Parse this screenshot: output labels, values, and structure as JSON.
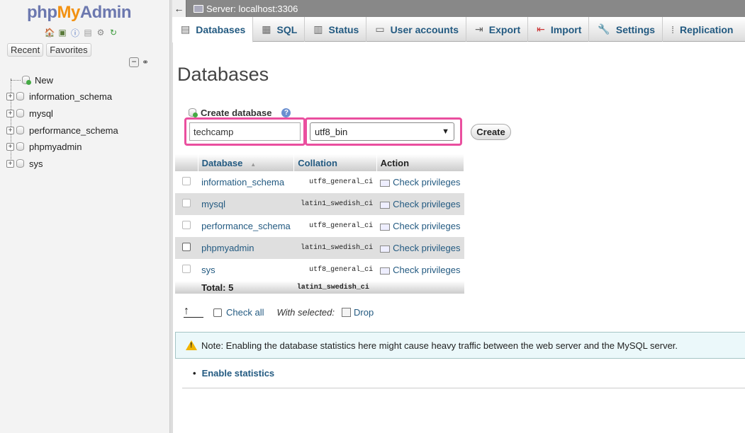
{
  "app": {
    "logo_php": "php",
    "logo_my": "My",
    "logo_admin": "Admin"
  },
  "sidebar": {
    "quick_icons": [
      "home-icon",
      "exit-icon",
      "help-icon",
      "docs-icon",
      "settings-icon",
      "reload-icon"
    ],
    "recent_label": "Recent",
    "favorites_label": "Favorites",
    "new_label": "New",
    "databases": [
      "information_schema",
      "mysql",
      "performance_schema",
      "phpmyadmin",
      "sys"
    ]
  },
  "topbar": {
    "back_label": "←",
    "server_label": "Server: localhost:3306"
  },
  "tabs": [
    {
      "label": "Databases",
      "icon": "database-icon",
      "active": true
    },
    {
      "label": "SQL",
      "icon": "sql-icon"
    },
    {
      "label": "Status",
      "icon": "status-icon"
    },
    {
      "label": "User accounts",
      "icon": "users-icon"
    },
    {
      "label": "Export",
      "icon": "export-icon"
    },
    {
      "label": "Import",
      "icon": "import-icon"
    },
    {
      "label": "Settings",
      "icon": "wrench-icon"
    },
    {
      "label": "Replication",
      "icon": "replication-icon"
    }
  ],
  "page_title": "Databases",
  "create_db": {
    "label": "Create database",
    "name_value": "techcamp",
    "collation_value": "utf8_bin",
    "create_label": "Create"
  },
  "table": {
    "headers": {
      "database": "Database",
      "sort_indicator": "▲",
      "collation": "Collation",
      "action": "Action"
    },
    "rows": [
      {
        "name": "information_schema",
        "collation": "utf8_general_ci",
        "action": "Check privileges"
      },
      {
        "name": "mysql",
        "collation": "latin1_swedish_ci",
        "action": "Check privileges"
      },
      {
        "name": "performance_schema",
        "collation": "utf8_general_ci",
        "action": "Check privileges"
      },
      {
        "name": "phpmyadmin",
        "collation": "latin1_swedish_ci",
        "action": "Check privileges"
      },
      {
        "name": "sys",
        "collation": "utf8_general_ci",
        "action": "Check privileges"
      }
    ],
    "total_label": "Total: 5",
    "total_collation": "latin1_swedish_ci"
  },
  "bulk": {
    "check_all": "Check all",
    "with_selected": "With selected:",
    "drop": "Drop"
  },
  "note": "Note: Enabling the database statistics here might cause heavy traffic between the web server and the MySQL server.",
  "enable_stats": "Enable statistics",
  "colors": {
    "accent": "#235a81",
    "highlight": "#ea4f9f",
    "note_bg": "#ebf8fa"
  }
}
